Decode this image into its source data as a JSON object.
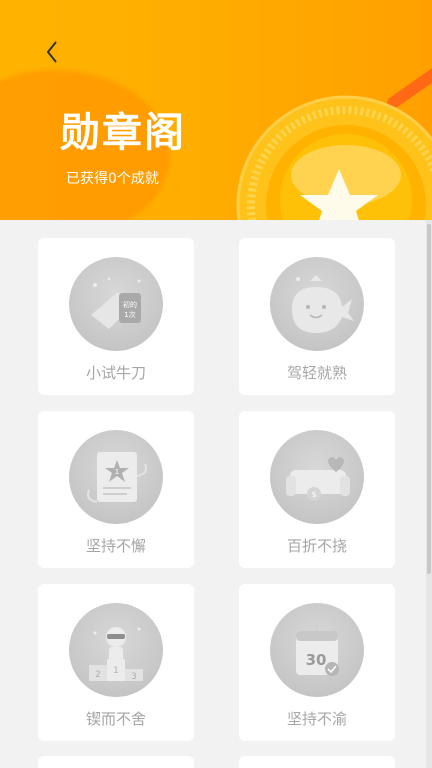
{
  "header": {
    "title": "勋章阁",
    "subtitle": "已获得0个成就",
    "colors": {
      "background": "#ffb000",
      "text": "#ffffff"
    }
  },
  "back_icon": "chevron-left-icon",
  "badges": [
    {
      "label": "小试牛刀",
      "icon": "tag-first-icon",
      "tag_text": "初的\n1次"
    },
    {
      "label": "驾轻就熟",
      "icon": "whale-icon"
    },
    {
      "label": "坚持不懈",
      "icon": "certificate-star-icon",
      "tag_text": "1"
    },
    {
      "label": "百折不挠",
      "icon": "sofa-heart-icon"
    },
    {
      "label": "锲而不舍",
      "icon": "podium-icon",
      "tag_text": "2 1 3"
    },
    {
      "label": "坚持不渝",
      "icon": "calendar-30-icon",
      "tag_text": "30"
    }
  ],
  "colors": {
    "card_bg": "#ffffff",
    "label": "#a6a6a6",
    "page_bg": "#f2f2f2"
  }
}
